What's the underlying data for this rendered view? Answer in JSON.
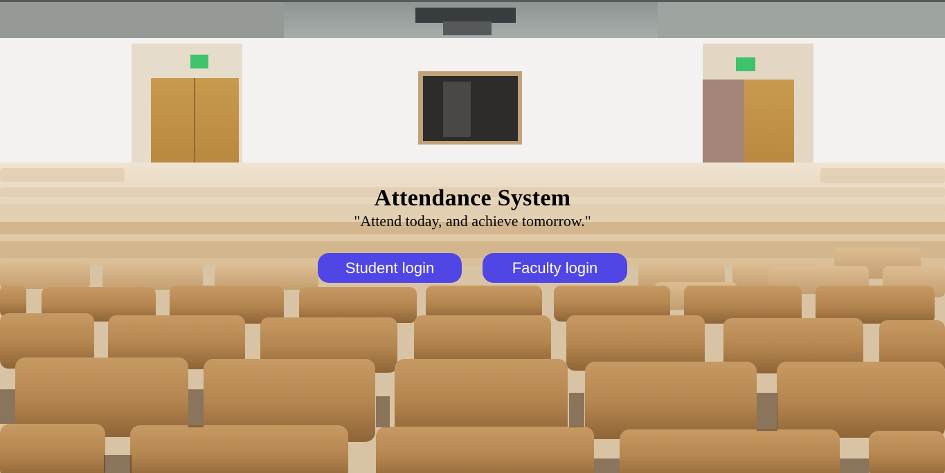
{
  "hero": {
    "title": "Attendance System",
    "tagline": "\"Attend today, and achieve tomorrow.\""
  },
  "buttons": {
    "student_login": "Student login",
    "faculty_login": "Faculty login"
  },
  "colors": {
    "button_bg": "#4f46e5",
    "button_text": "#ffffff"
  },
  "background": {
    "image": "lecture-hall-photo"
  }
}
